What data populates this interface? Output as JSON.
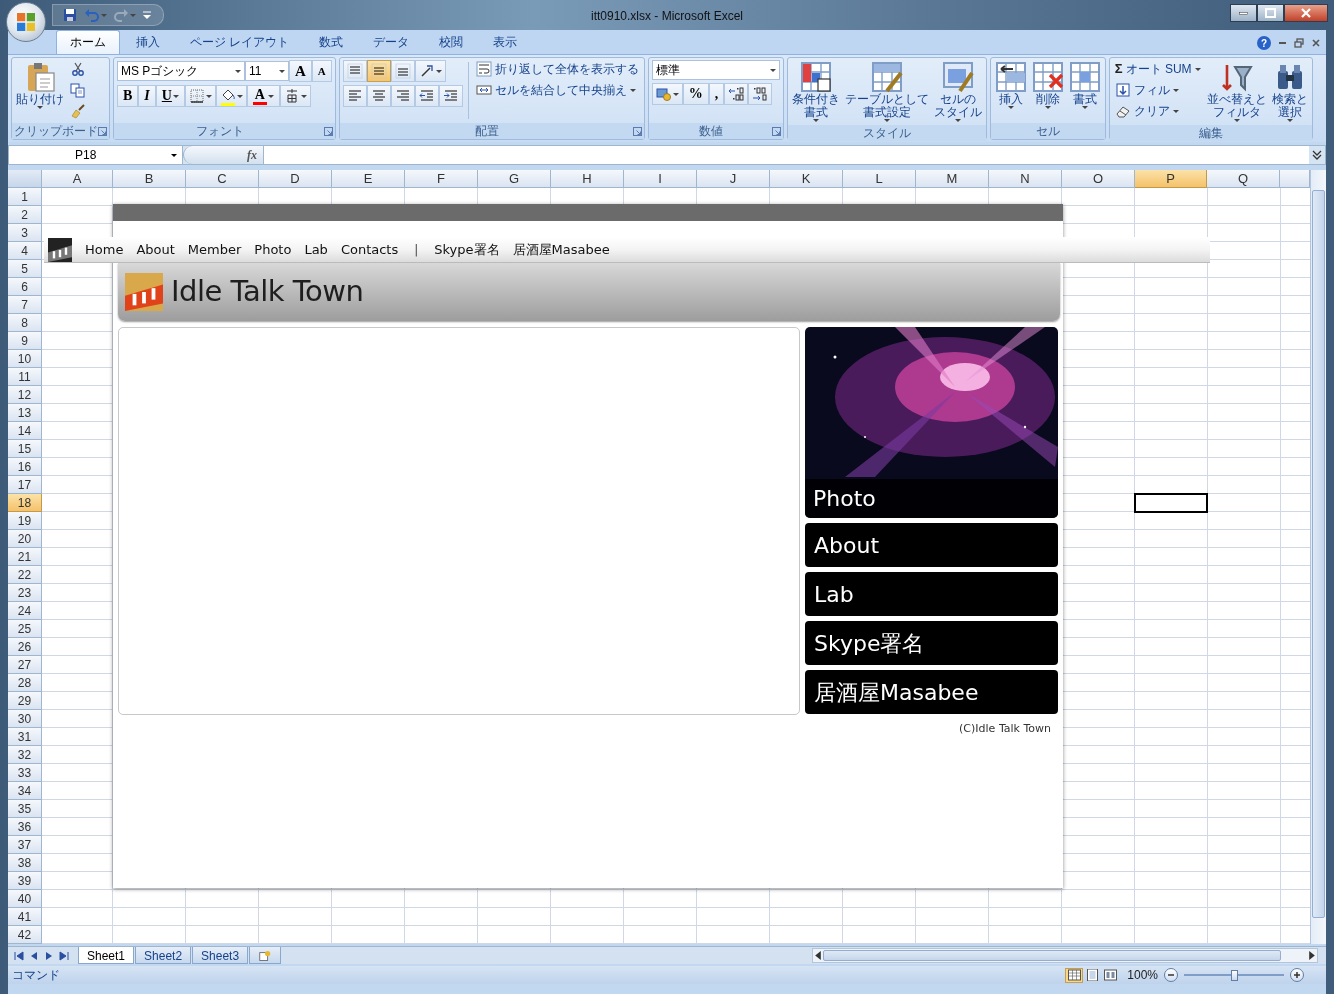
{
  "window": {
    "title": "itt0910.xlsx - Microsoft Excel"
  },
  "ribbon_tabs": [
    {
      "label": "ホーム",
      "selected": true
    },
    {
      "label": "挿入",
      "selected": false
    },
    {
      "label": "ページ レイアウト",
      "selected": false
    },
    {
      "label": "数式",
      "selected": false
    },
    {
      "label": "データ",
      "selected": false
    },
    {
      "label": "校閲",
      "selected": false
    },
    {
      "label": "表示",
      "selected": false
    }
  ],
  "help": "?",
  "ribbon_groups": [
    {
      "label": "クリップボード",
      "launcher": true,
      "items": [
        {
          "kind": "large",
          "lines": [
            "貼り付け"
          ],
          "dropdown": true
        },
        {
          "kind": "stack",
          "items": [
            {
              "kind": "icon"
            },
            {
              "kind": "icon"
            },
            {
              "kind": "icon"
            }
          ]
        }
      ]
    },
    {
      "label": "フォント",
      "launcher": true,
      "items": [
        {
          "kind": "stack",
          "items": [
            {
              "kind": "row",
              "items": [
                {
                  "kind": "field",
                  "value": "MS Pゴシック"
                },
                {
                  "kind": "sizefield",
                  "value": "11"
                },
                {
                  "kind": "grow",
                  "label": "A"
                },
                {
                  "kind": "shrink",
                  "label": "A"
                }
              ]
            },
            {
              "kind": "row",
              "items": [
                {
                  "kind": "bold",
                  "label": "B"
                },
                {
                  "kind": "italic",
                  "label": "I"
                },
                {
                  "kind": "underline",
                  "label": "U",
                  "dropdown": true
                },
                {
                  "kind": "icon",
                  "dropdown": true
                },
                {
                  "kind": "icon",
                  "dropdown": true,
                  "color": "#ffff00"
                },
                {
                  "kind": "glyph",
                  "label": "A",
                  "dropdown": true,
                  "color": "#ff0000"
                },
                {
                  "kind": "icon",
                  "dropdown": true
                }
              ]
            }
          ]
        }
      ]
    },
    {
      "label": "配置",
      "launcher": true,
      "items": [
        {
          "kind": "stack",
          "items": [
            {
              "kind": "row",
              "items": [
                {
                  "kind": "icon",
                  "selected": false
                },
                {
                  "kind": "icon",
                  "selected": true
                },
                {
                  "kind": "icon",
                  "selected": false
                },
                {
                  "kind": "icon",
                  "dropdown": true
                }
              ]
            },
            {
              "kind": "row",
              "items": [
                {
                  "kind": "icon"
                },
                {
                  "kind": "icon"
                },
                {
                  "kind": "icon"
                },
                {
                  "kind": "icon"
                },
                {
                  "kind": "icon"
                }
              ]
            }
          ]
        },
        {
          "kind": "stack",
          "items": [
            {
              "kind": "button",
              "label": "折り返して全体を表示する"
            },
            {
              "kind": "button",
              "label": "セルを結合して中央揃え",
              "dropdown": true
            }
          ]
        }
      ]
    },
    {
      "label": "数値",
      "launcher": true,
      "items": [
        {
          "kind": "stack",
          "items": [
            {
              "kind": "field",
              "value": "標準"
            },
            {
              "kind": "row",
              "items": [
                {
                  "kind": "icon",
                  "dropdown": true
                },
                {
                  "kind": "glyph",
                  "label": "%"
                },
                {
                  "kind": "glyph",
                  "label": ","
                },
                {
                  "kind": "icon"
                },
                {
                  "kind": "icon"
                }
              ]
            }
          ]
        }
      ]
    },
    {
      "label": "スタイル",
      "launcher": false,
      "items": [
        {
          "kind": "large",
          "lines": [
            "条件付き",
            "書式"
          ],
          "dropdown": true
        },
        {
          "kind": "large",
          "lines": [
            "テーブルとして",
            "書式設定"
          ],
          "dropdown": true
        },
        {
          "kind": "large",
          "lines": [
            "セルの",
            "スタイル"
          ],
          "dropdown": true
        }
      ]
    },
    {
      "label": "セル",
      "launcher": false,
      "items": [
        {
          "kind": "large",
          "lines": [
            "挿入"
          ],
          "dropdown": true
        },
        {
          "kind": "large",
          "lines": [
            "削除"
          ],
          "dropdown": true
        },
        {
          "kind": "large",
          "lines": [
            "書式"
          ],
          "dropdown": true
        }
      ]
    },
    {
      "label": "編集",
      "launcher": false,
      "items": [
        {
          "kind": "stack",
          "items": [
            {
              "kind": "button",
              "symbol": "Σ",
              "label": "オート SUM",
              "dropdown": true
            },
            {
              "kind": "button",
              "label": "フィル",
              "dropdown": true
            },
            {
              "kind": "button",
              "label": "クリア",
              "dropdown": true
            }
          ]
        },
        {
          "kind": "large",
          "lines": [
            "並べ替えと",
            "フィルタ"
          ],
          "dropdown": true
        },
        {
          "kind": "large",
          "lines": [
            "検索と",
            "選択"
          ],
          "dropdown": true
        }
      ]
    }
  ],
  "formula_bar": {
    "name_box": "P18",
    "fx": "fx"
  },
  "columns": [
    {
      "label": "A",
      "selected": false
    },
    {
      "label": "B",
      "selected": false
    },
    {
      "label": "C",
      "selected": false
    },
    {
      "label": "D",
      "selected": false
    },
    {
      "label": "E",
      "selected": false
    },
    {
      "label": "F",
      "selected": false
    },
    {
      "label": "G",
      "selected": false
    },
    {
      "label": "H",
      "selected": false
    },
    {
      "label": "I",
      "selected": false
    },
    {
      "label": "J",
      "selected": false
    },
    {
      "label": "K",
      "selected": false
    },
    {
      "label": "L",
      "selected": false
    },
    {
      "label": "M",
      "selected": false
    },
    {
      "label": "N",
      "selected": false
    },
    {
      "label": "O",
      "selected": false
    },
    {
      "label": "P",
      "selected": true
    },
    {
      "label": "Q",
      "selected": false
    }
  ],
  "rows": [
    {
      "label": "1",
      "selected": false
    },
    {
      "label": "2",
      "selected": false
    },
    {
      "label": "3",
      "selected": false
    },
    {
      "label": "4",
      "selected": false
    },
    {
      "label": "5",
      "selected": false
    },
    {
      "label": "6",
      "selected": false
    },
    {
      "label": "7",
      "selected": false
    },
    {
      "label": "8",
      "selected": false
    },
    {
      "label": "9",
      "selected": false
    },
    {
      "label": "10",
      "selected": false
    },
    {
      "label": "11",
      "selected": false
    },
    {
      "label": "12",
      "selected": false
    },
    {
      "label": "13",
      "selected": false
    },
    {
      "label": "14",
      "selected": false
    },
    {
      "label": "15",
      "selected": false
    },
    {
      "label": "16",
      "selected": false
    },
    {
      "label": "17",
      "selected": false
    },
    {
      "label": "18",
      "selected": true
    },
    {
      "label": "19",
      "selected": false
    },
    {
      "label": "20",
      "selected": false
    },
    {
      "label": "21",
      "selected": false
    },
    {
      "label": "22",
      "selected": false
    },
    {
      "label": "23",
      "selected": false
    },
    {
      "label": "24",
      "selected": false
    },
    {
      "label": "25",
      "selected": false
    },
    {
      "label": "26",
      "selected": false
    },
    {
      "label": "27",
      "selected": false
    },
    {
      "label": "28",
      "selected": false
    },
    {
      "label": "29",
      "selected": false
    },
    {
      "label": "30",
      "selected": false
    },
    {
      "label": "31",
      "selected": false
    },
    {
      "label": "32",
      "selected": false
    },
    {
      "label": "33",
      "selected": false
    },
    {
      "label": "34",
      "selected": false
    },
    {
      "label": "35",
      "selected": false
    },
    {
      "label": "36",
      "selected": false
    },
    {
      "label": "37",
      "selected": false
    },
    {
      "label": "38",
      "selected": false
    },
    {
      "label": "39",
      "selected": false
    },
    {
      "label": "40",
      "selected": false
    },
    {
      "label": "41",
      "selected": false
    },
    {
      "label": "42",
      "selected": false
    }
  ],
  "embedded_page": {
    "nav": [
      {
        "kind": "link",
        "label": "Home"
      },
      {
        "kind": "link",
        "label": "About"
      },
      {
        "kind": "link",
        "label": "Member"
      },
      {
        "kind": "link",
        "label": "Photo"
      },
      {
        "kind": "link",
        "label": "Lab"
      },
      {
        "kind": "link",
        "label": "Contacts"
      },
      {
        "kind": "divider",
        "label": "|"
      },
      {
        "kind": "link",
        "label": "Skype署名"
      },
      {
        "kind": "link",
        "label": "居酒屋Masabee"
      }
    ],
    "title": "Idle Talk Town",
    "side_menu": [
      {
        "kind": "picture",
        "label": "Photo"
      },
      {
        "kind": "button",
        "label": "About"
      },
      {
        "kind": "button",
        "label": "Lab"
      },
      {
        "kind": "button",
        "label": "Skype署名"
      },
      {
        "kind": "button",
        "label": "居酒屋Masabee"
      }
    ],
    "footer": "(C)Idle Talk Town"
  },
  "sheet_tabs": [
    {
      "label": "Sheet1",
      "selected": true
    },
    {
      "label": "Sheet2",
      "selected": false
    },
    {
      "label": "Sheet3",
      "selected": false
    }
  ],
  "status_bar": {
    "mode": "コマンド",
    "views": [
      {
        "selected": true
      },
      {
        "selected": false
      },
      {
        "selected": false
      }
    ],
    "zoom": "100%",
    "zoom_slider": {
      "level": 0.5
    }
  }
}
